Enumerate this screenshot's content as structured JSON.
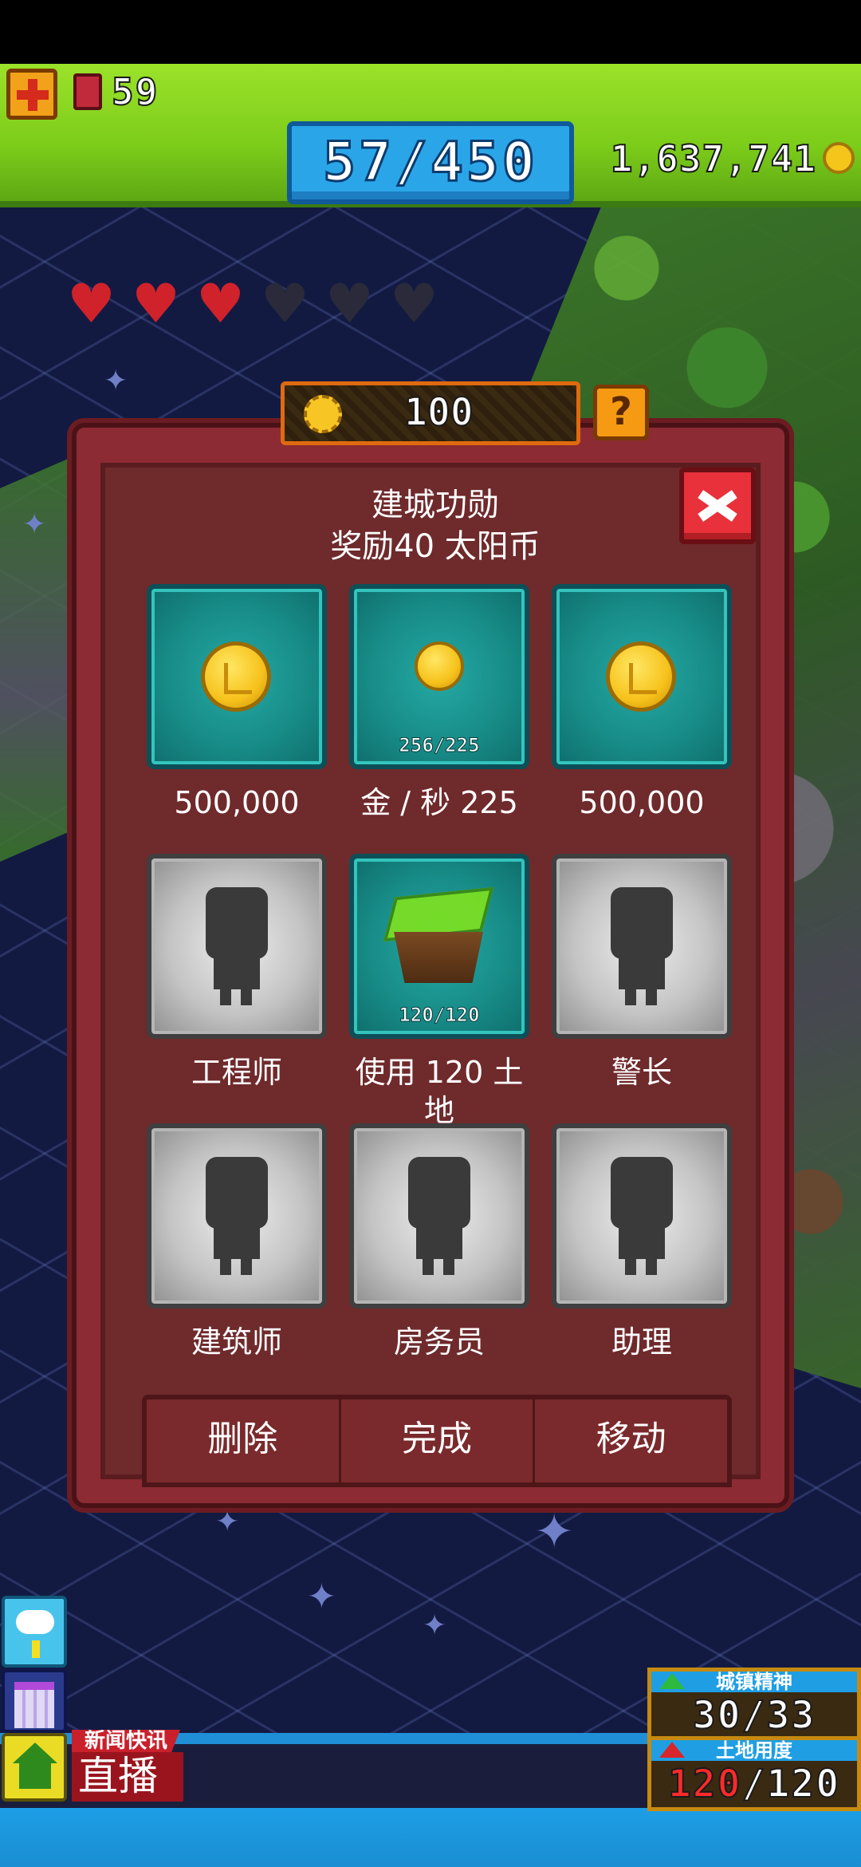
{
  "top_bar": {
    "ticket_count": "59",
    "population": "57/450",
    "coins": "1,637,741"
  },
  "hearts": {
    "filled": 3,
    "total": 6
  },
  "sun_bar": {
    "value": "100"
  },
  "panel": {
    "title": "建城功勋",
    "subtitle": "奖励40 太阳币",
    "cells": [
      {
        "label": "500,000",
        "type": "coin",
        "progress": ""
      },
      {
        "label": "金 / 秒 225",
        "type": "coin-small",
        "progress": "256/225"
      },
      {
        "label": "500,000",
        "type": "coin",
        "progress": ""
      },
      {
        "label": "工程师",
        "type": "locked",
        "progress": ""
      },
      {
        "label": "使用 120 土地",
        "type": "land",
        "progress": "120/120"
      },
      {
        "label": "警长",
        "type": "locked",
        "progress": ""
      },
      {
        "label": "建筑师",
        "type": "locked",
        "progress": ""
      },
      {
        "label": "房务员",
        "type": "locked",
        "progress": ""
      },
      {
        "label": "助理",
        "type": "locked",
        "progress": ""
      }
    ],
    "actions": {
      "delete": "删除",
      "done": "完成",
      "move": "移动"
    }
  },
  "news": {
    "label": "新闻快讯",
    "live": "直播"
  },
  "stats": {
    "spirit_label": "城镇精神",
    "spirit_value": "30/33",
    "land_label": "土地用度",
    "land_used": "120",
    "land_total": "/120"
  },
  "colors": {
    "top_bar": "#7ccc1a",
    "panel": "#8c2b33",
    "tile_teal": "#178a86",
    "tile_gray": "#c4c4c4",
    "close": "#e8313a",
    "heart": "#d0222b"
  }
}
